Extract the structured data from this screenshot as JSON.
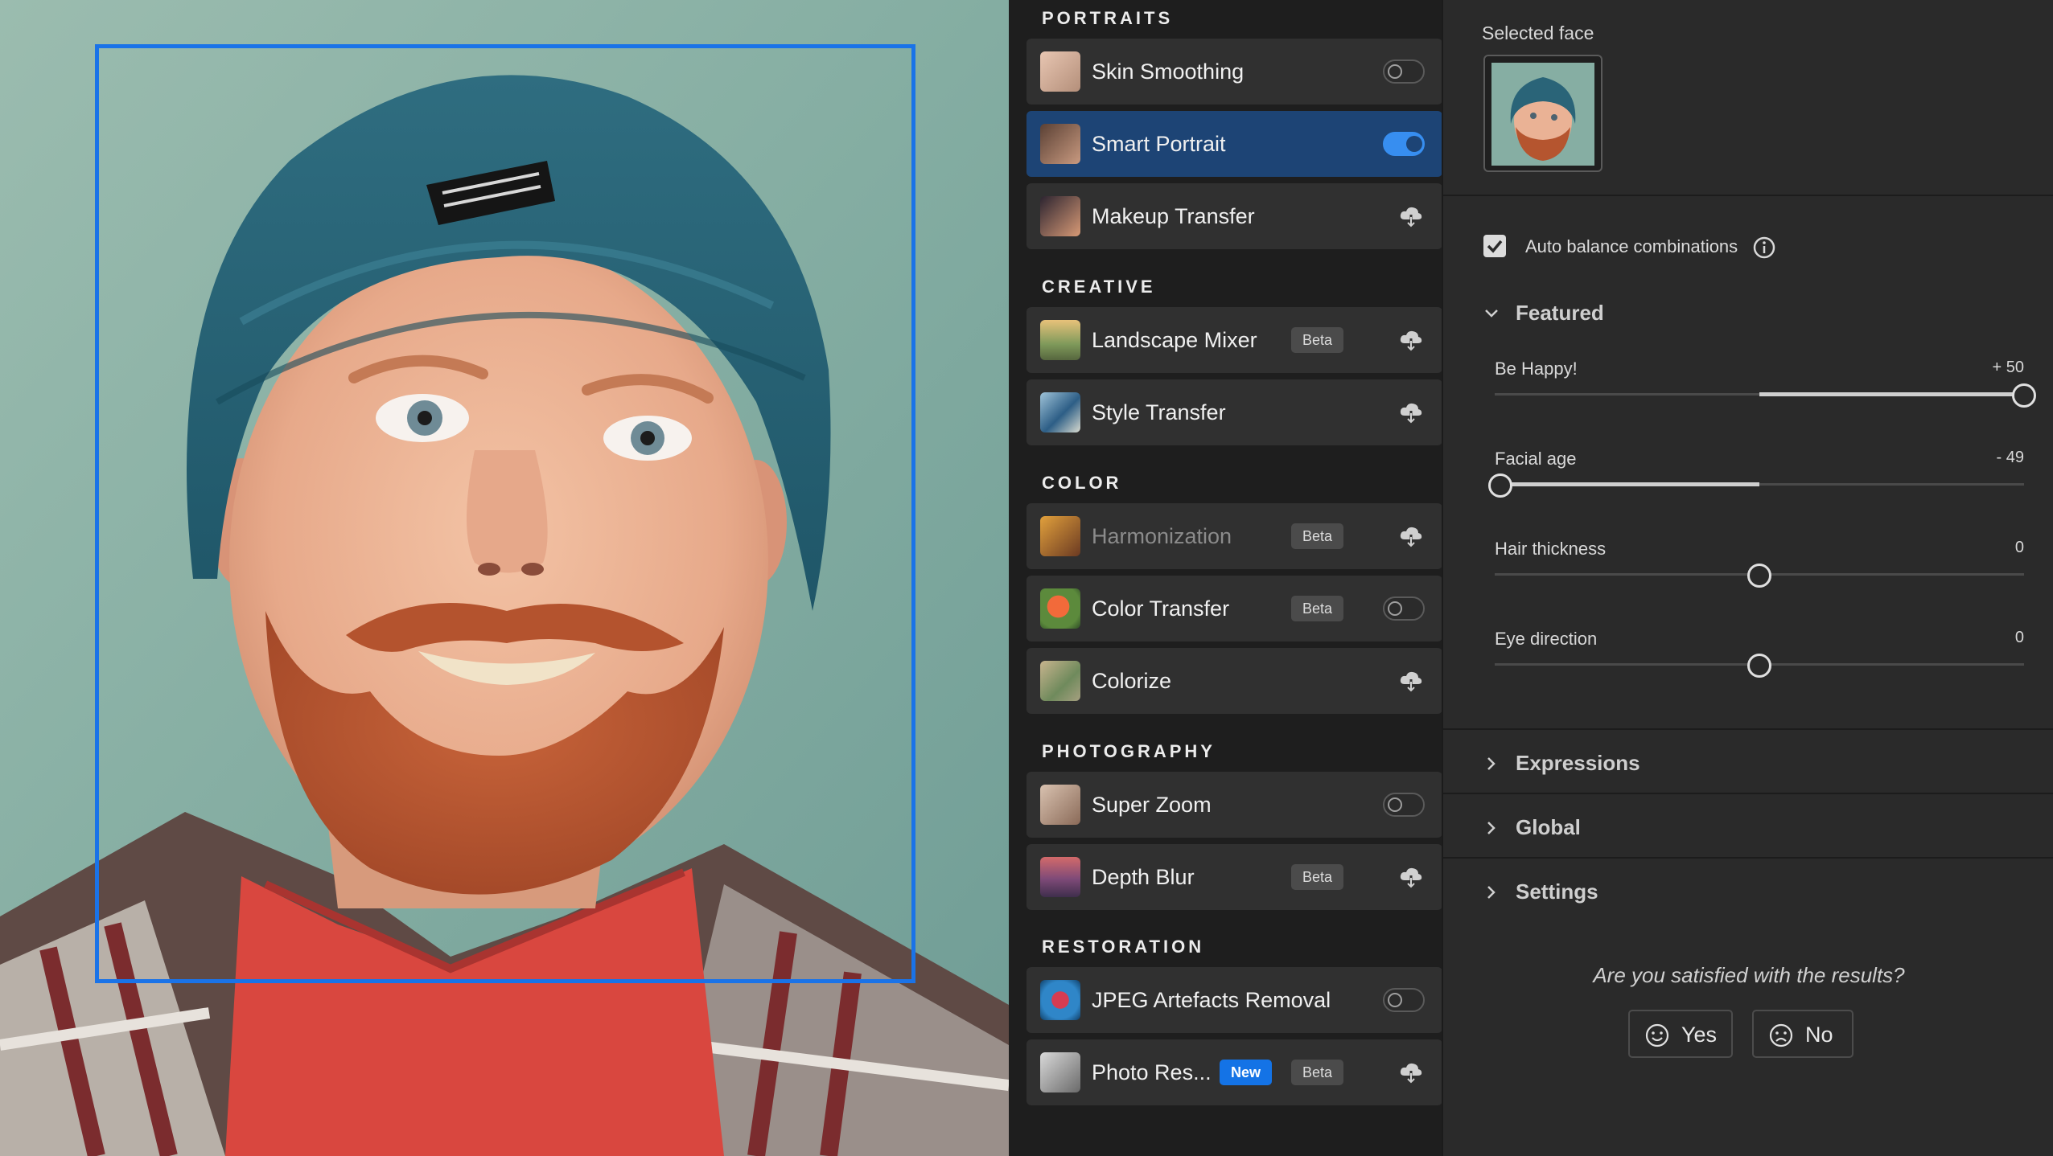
{
  "filters": {
    "categories": {
      "portraits": "PORTRAITS",
      "creative": "CREATIVE",
      "color": "COLOR",
      "photography": "PHOTOGRAPHY",
      "restoration": "RESTORATION"
    },
    "items": [
      {
        "label": "Skin Smoothing",
        "control": "toggle",
        "state": "off"
      },
      {
        "label": "Smart Portrait",
        "control": "toggle",
        "state": "on",
        "selected": true
      },
      {
        "label": "Makeup Transfer",
        "control": "download-cloud-icon"
      },
      {
        "label": "Landscape Mixer",
        "badge": "Beta",
        "control": "download-cloud-icon"
      },
      {
        "label": "Style Transfer",
        "control": "download-cloud-icon"
      },
      {
        "label": "Harmonization",
        "badge": "Beta",
        "control": "download-cloud-icon",
        "disabled": true
      },
      {
        "label": "Color Transfer",
        "badge": "Beta",
        "control": "toggle",
        "state": "off"
      },
      {
        "label": "Colorize",
        "control": "download-cloud-icon"
      },
      {
        "label": "Super Zoom",
        "control": "toggle",
        "state": "off"
      },
      {
        "label": "Depth Blur",
        "badge": "Beta",
        "control": "download-cloud-icon"
      },
      {
        "label": "JPEG Artefacts Removal",
        "control": "toggle",
        "state": "off"
      },
      {
        "label": "Photo Res...",
        "badge_new": "New",
        "badge": "Beta",
        "control": "download-cloud-icon"
      }
    ]
  },
  "props": {
    "selected_face_label": "Selected face",
    "auto_balance": {
      "label": "Auto balance combinations",
      "checked": true
    },
    "featured": {
      "title": "Featured",
      "expanded": true,
      "sliders": [
        {
          "name": "Be Happy!",
          "value_text": "+ 50",
          "value": 50,
          "min": -50,
          "max": 50
        },
        {
          "name": "Facial age",
          "value_text": "- 49",
          "value": -49,
          "min": -50,
          "max": 50
        },
        {
          "name": "Hair thickness",
          "value_text": "0",
          "value": 0,
          "min": -50,
          "max": 50
        },
        {
          "name": "Eye direction",
          "value_text": "0",
          "value": 0,
          "min": -50,
          "max": 50
        }
      ]
    },
    "sections": [
      "Expressions",
      "Global",
      "Settings"
    ],
    "feedback": {
      "question": "Are you satisfied with the results?",
      "yes": "Yes",
      "no": "No"
    }
  },
  "colors": {
    "accent": "#1473e6",
    "selection_box": "#1a73e8",
    "active_row": "#1d4475",
    "panel_bg": "#2a2a2a",
    "list_bg": "#1e1e1e"
  }
}
